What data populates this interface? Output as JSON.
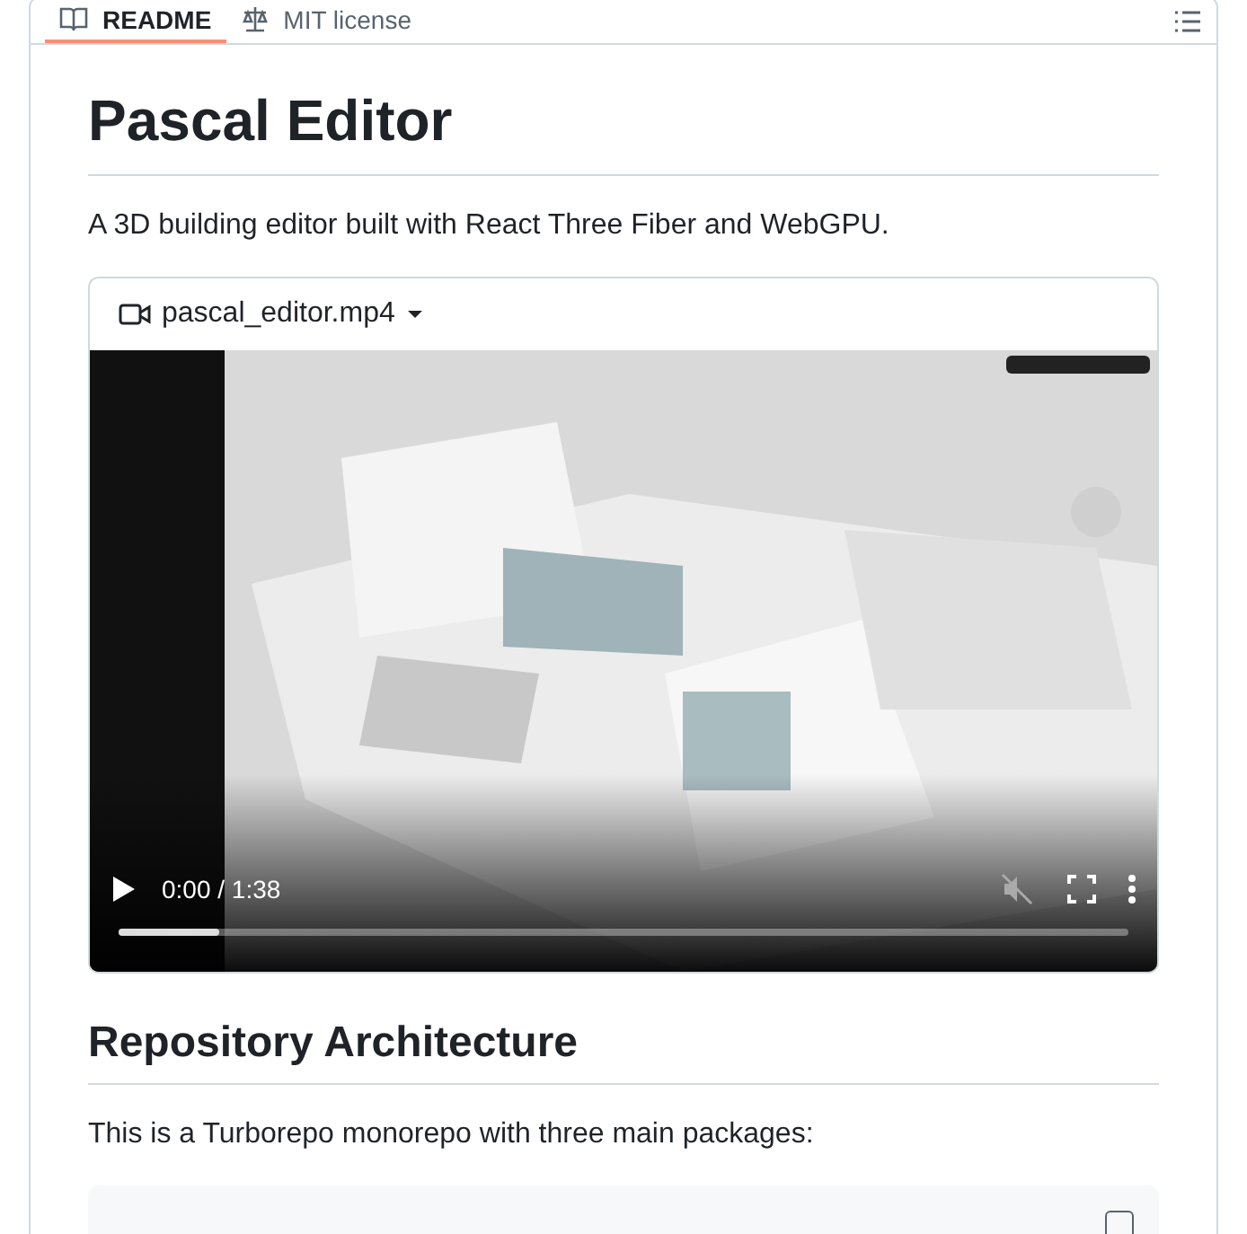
{
  "tabs": [
    {
      "label": "README",
      "selected": true,
      "kind": "book"
    },
    {
      "label": "MIT license",
      "selected": false,
      "kind": "scale"
    }
  ],
  "title": "Pascal Editor",
  "intro": "A 3D building editor built with React Three Fiber and WebGPU.",
  "video": {
    "filename": "pascal_editor.mp4",
    "time": "0:00 / 1:38",
    "level": 0.1,
    "muted": true,
    "kind": "picture"
  },
  "section_heading": "Repository Architecture",
  "section_text": "This is a Turborepo monorepo with three main packages:"
}
